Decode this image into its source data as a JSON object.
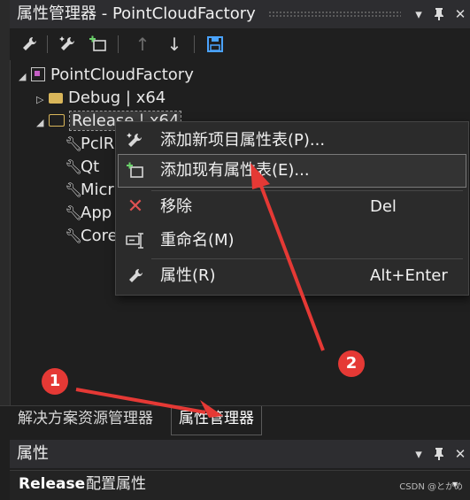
{
  "panel": {
    "title": "属性管理器 - PointCloudFactory",
    "dropdown_glyph": "▾",
    "pin_glyph": "⊥",
    "close_glyph": "✕"
  },
  "toolbar": {
    "properties_icon": "wrench-icon",
    "add_new_icon": "wand-icon",
    "add_existing_icon": "add-sheet-icon",
    "move_up_icon": "arrow-up-icon",
    "move_down_icon": "arrow-down-icon",
    "save_icon": "save-icon"
  },
  "tree": {
    "project": "PointCloudFactory",
    "configs": [
      {
        "label": "Debug | x64"
      },
      {
        "label": "Release | x64"
      }
    ],
    "sheets": [
      {
        "label": "PclR"
      },
      {
        "label": "Qt"
      },
      {
        "label": "Micr"
      },
      {
        "label": "App"
      },
      {
        "label": "Core"
      }
    ]
  },
  "context_menu": {
    "items": [
      {
        "label": "添加新项目属性表(P)...",
        "shortcut": ""
      },
      {
        "label": "添加现有属性表(E)...",
        "shortcut": ""
      },
      {
        "label": "移除",
        "shortcut": "Del"
      },
      {
        "label": "重命名(M)",
        "shortcut": ""
      },
      {
        "label": "属性(R)",
        "shortcut": "Alt+Enter"
      }
    ]
  },
  "bottom_tabs": [
    {
      "label": "解决方案资源管理器"
    },
    {
      "label": "属性管理器"
    }
  ],
  "properties_panel": {
    "title": "属性",
    "config_name": "Release",
    "config_label": "配置属性"
  },
  "annotations": {
    "badge1": "1",
    "badge2": "2",
    "color": "#e53935"
  },
  "watermark": "CSDN @とかめ"
}
